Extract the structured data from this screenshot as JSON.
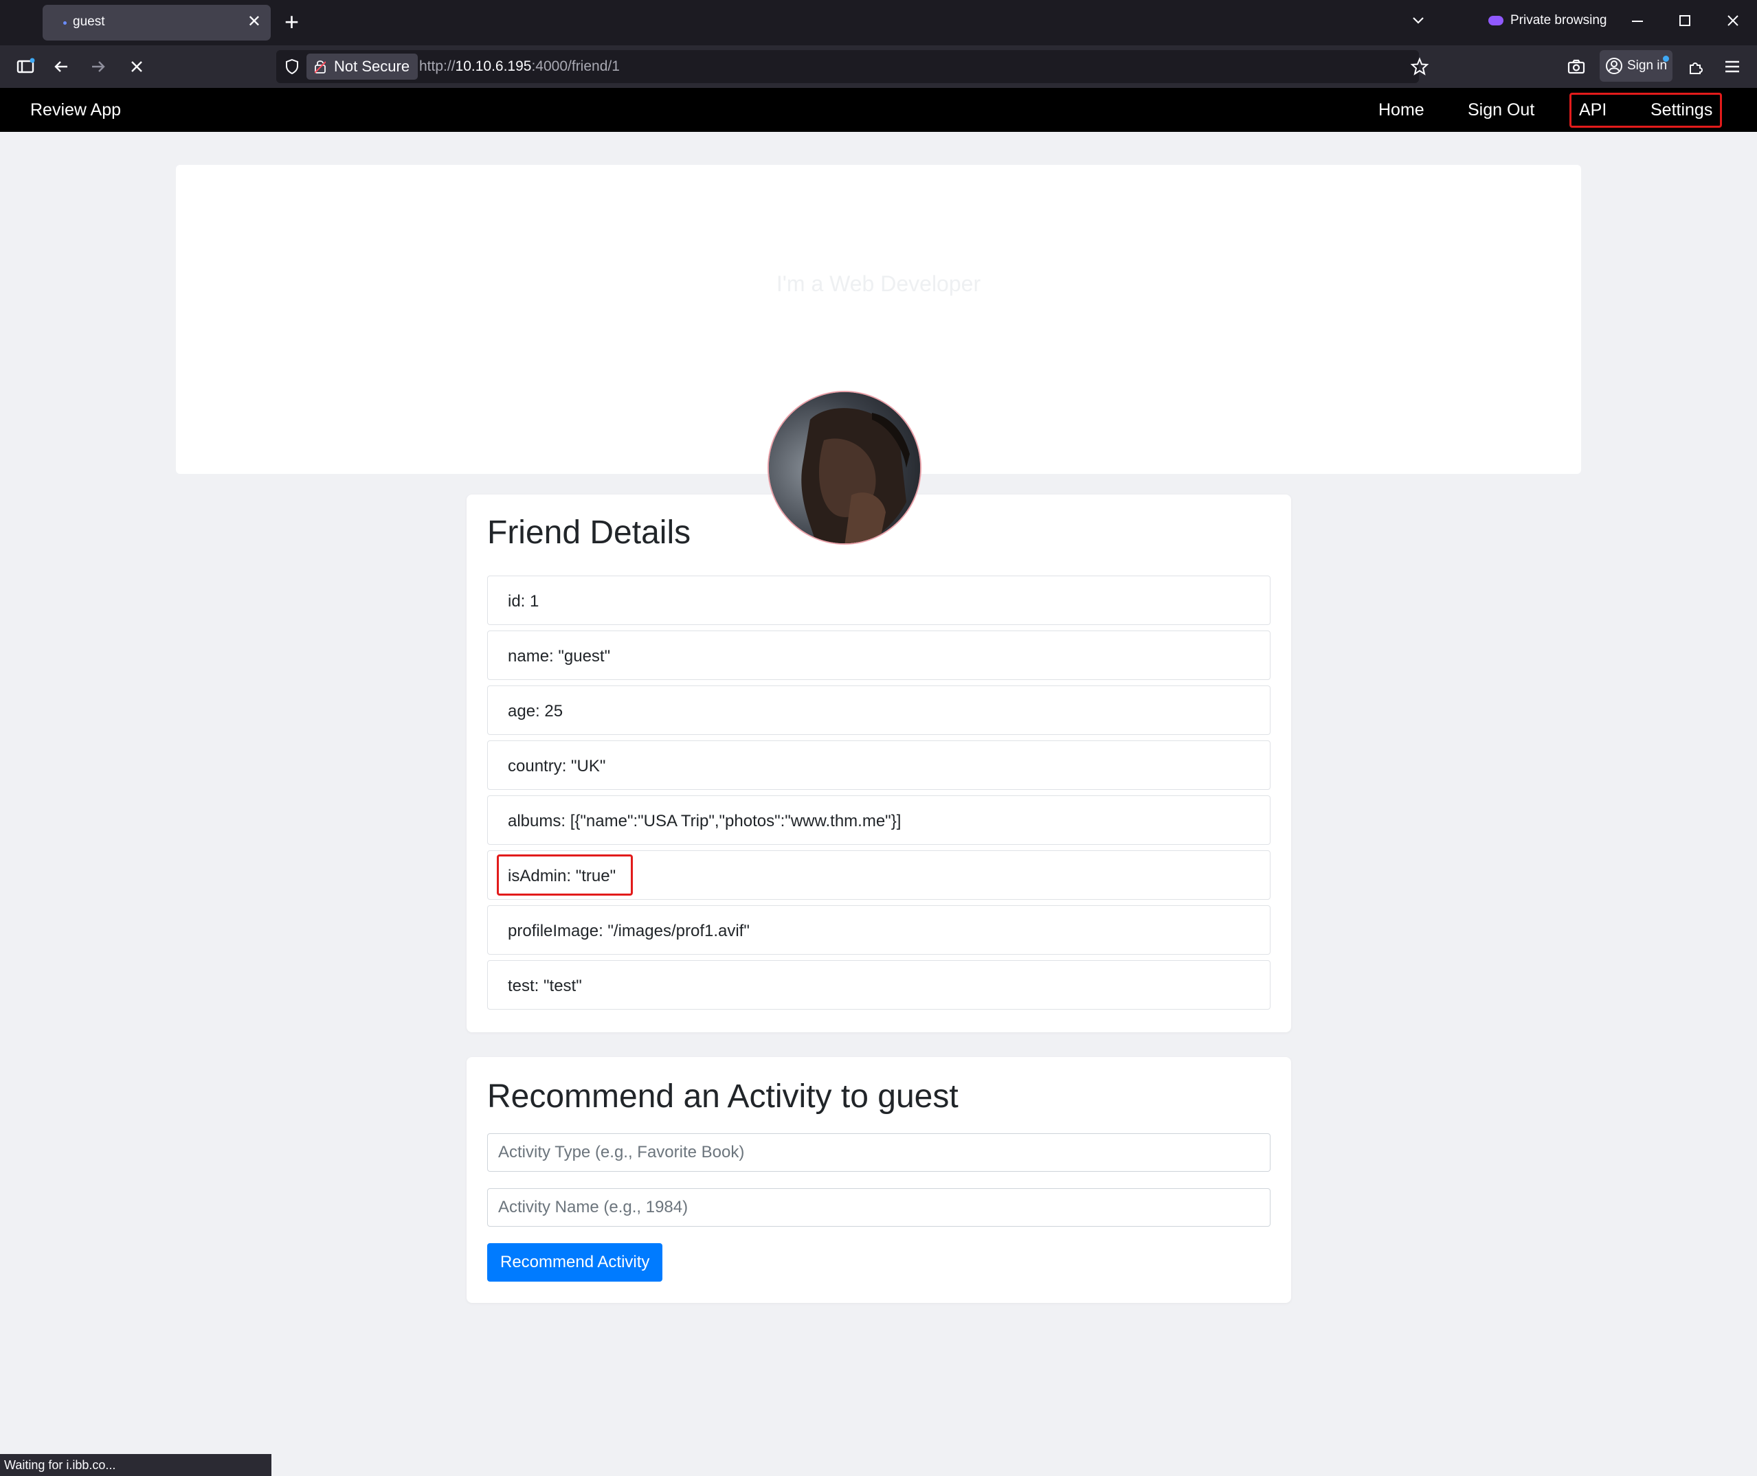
{
  "browser": {
    "tab_title": "guest",
    "tab_close": "✕",
    "new_tab": "+",
    "private_label": "Private browsing",
    "security_label": "Not Secure",
    "url_scheme": "http://",
    "url_host": "10.10.6.195",
    "url_rest": ":4000/friend/1",
    "signin_label": "Sign in",
    "status_text": "Waiting for i.ibb.co..."
  },
  "app": {
    "brand": "Review App",
    "nav": {
      "home": "Home",
      "signout": "Sign Out",
      "api": "API",
      "settings": "Settings"
    }
  },
  "hero": {
    "tagline": "I'm a Web Developer"
  },
  "friend_details": {
    "heading": "Friend Details",
    "rows": [
      "id: 1",
      "name: \"guest\"",
      "age: 25",
      "country: \"UK\"",
      "albums: [{\"name\":\"USA Trip\",\"photos\":\"www.thm.me\"}]",
      "isAdmin: \"true\"",
      "profileImage: \"/images/prof1.avif\"",
      "test: \"test\""
    ]
  },
  "recommend": {
    "heading": "Recommend an Activity to guest",
    "type_placeholder": "Activity Type (e.g., Favorite Book)",
    "name_placeholder": "Activity Name (e.g., 1984)",
    "button": "Recommend Activity"
  },
  "colors": {
    "highlight": "#e21b1b",
    "primary": "#007bff",
    "appbar": "#000000"
  }
}
